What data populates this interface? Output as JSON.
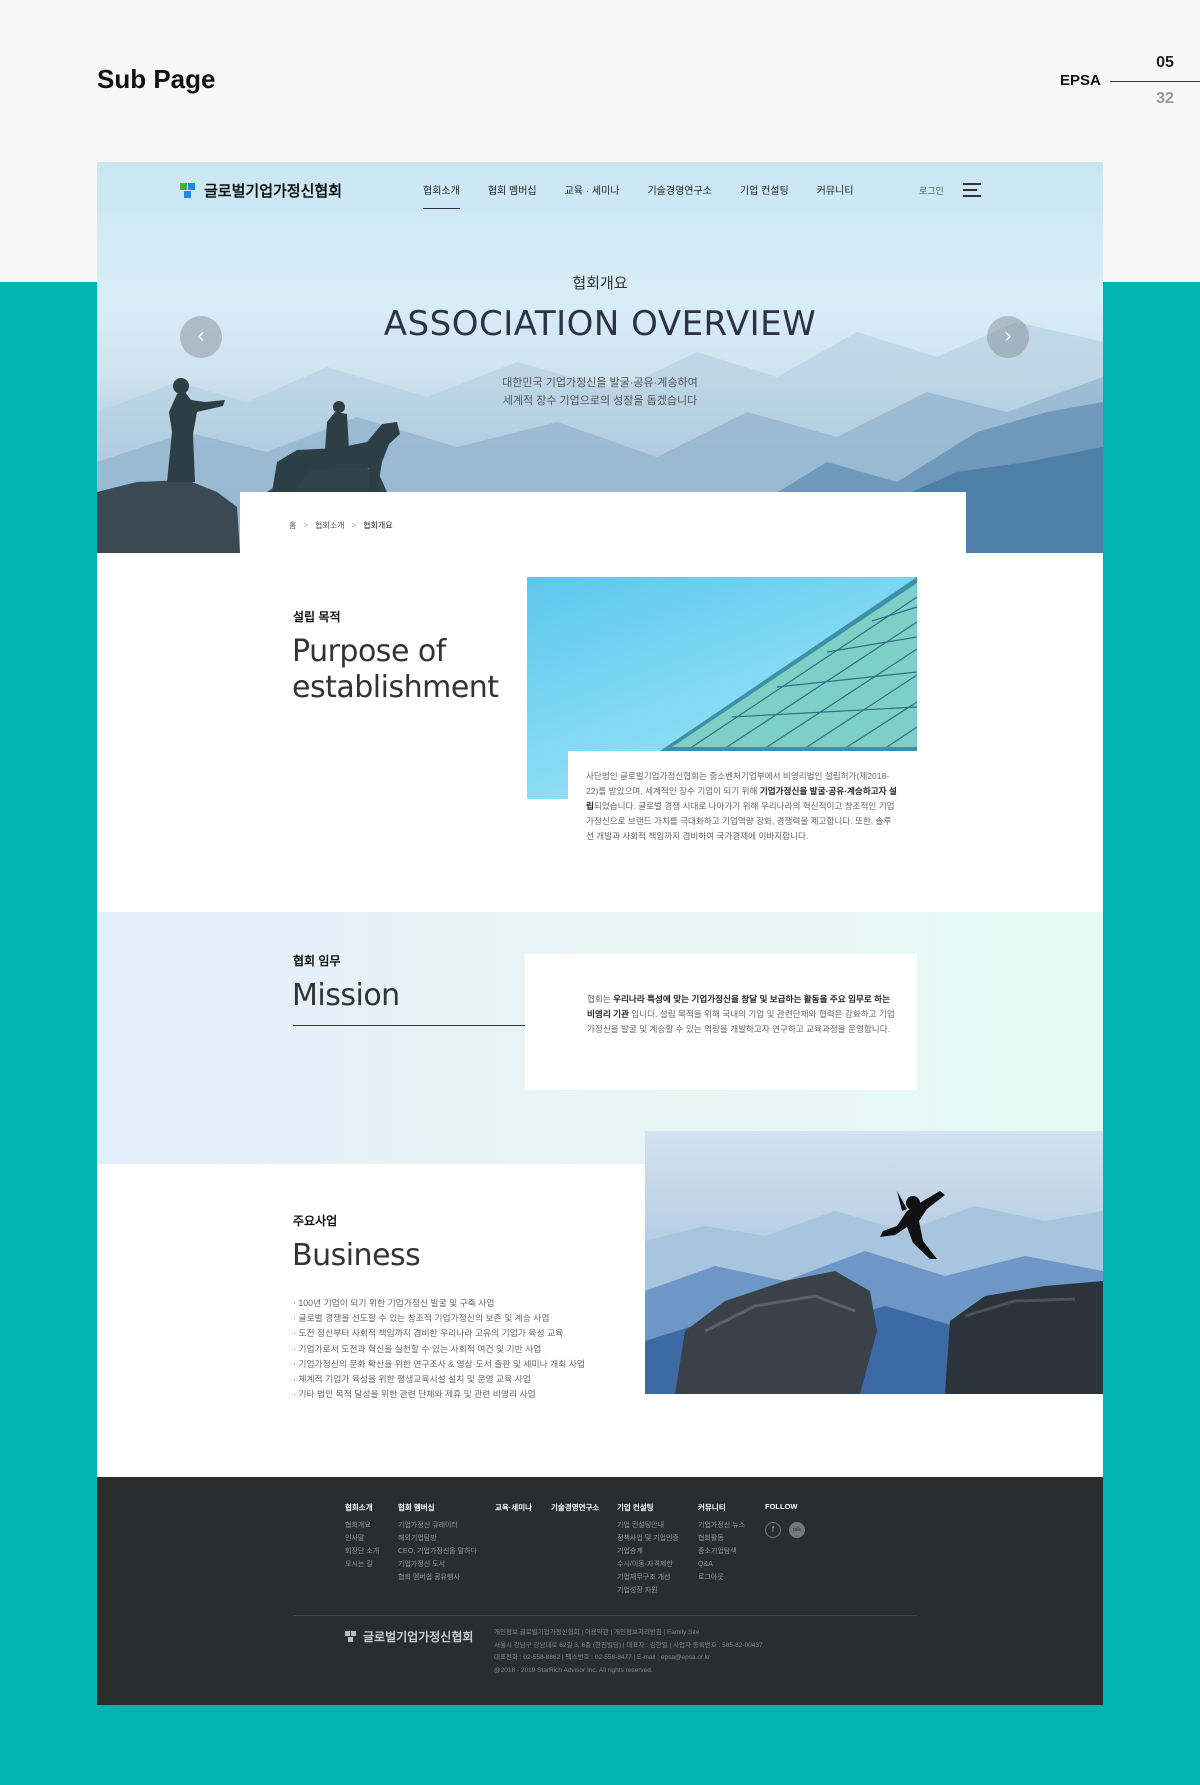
{
  "page": {
    "title": "Sub Page",
    "brand": "EPSA",
    "current_page": "05",
    "total_pages": "32"
  },
  "header": {
    "logo_text": "글로벌기업가정신협회",
    "nav": [
      "협회소개",
      "협회 멤버십",
      "교육 · 세미나",
      "기술경영연구소",
      "기업 컨설팅",
      "커뮤니티"
    ],
    "active_nav": "협회소개",
    "login": "로그인"
  },
  "hero": {
    "title_kr": "협회개요",
    "title_en": "ASSOCIATION OVERVIEW",
    "subtitle_1": "대한민국 기업가정신을 발굴·공유·계승하여",
    "subtitle_2": "세계적 장수 기업으로의 성장을 돕겠습니다",
    "prev": "‹",
    "next": "›"
  },
  "breadcrumb": [
    "홈",
    "협회소개",
    "협회개요"
  ],
  "purpose": {
    "label": "설립 목적",
    "title_1": "Purpose of",
    "title_2": "establishment",
    "body_1": "사단법인 글로벌기업가정신협회는 중소벤처기업부에서 비영리법인 설립허가(제2018-22)를 받았으며, 세계적인 장수 기업이 되기 위해 ",
    "body_bold": "기업가정신을 발굴·공유·계승하고자 설립",
    "body_2": "되었습니다. 글로벌 경쟁 시대로 나아가기 위해 우리나라의 혁신적이고 창조적인 기업가정신으로 브랜드 가치를 극대화하고 기업역량 강화, 경쟁력을 제고합니다. 또한, 솔루션 개발과 사회적 책임까지 겸비하여 국가경제에 이바지합니다."
  },
  "mission": {
    "label": "협회 임무",
    "title": "Mission",
    "body_1": "협회는 ",
    "body_bold": "우리나라 특성에 맞는 기업가정신을 창달 및 보급하는 활동을 주요 임무로 하는 비영리 기관",
    "body_2": " 입니다. 설립 목적을 위해 국내의 기업 및 관련단체와 협력은 강화하고 기업가정신을 발굴 및 계승할 수 있는 역량을 개발하고자 연구하고 교육과정을 운영합니다."
  },
  "business": {
    "label": "주요사업",
    "title": "Business",
    "items": [
      "· 100년 기업이 되기 위한 기업가정신 발굴 및 구축 사업",
      "· 글로벌 경쟁을 선도할 수 있는 창조적 기업가정신의 보존 및 계승 사업",
      "· 도전 정신부터 사회적 책임까지 겸비한 우리나라 고유의 기업가 육성 교육",
      "· 기업가로서 도전과 혁신을 실천할 수 있는 사회적 여건 및 기반 사업",
      "· 기업가정신의 문화 확산을 위한 연구조사 & 영상·도서 출판 및 세미나 개최 사업",
      "· 체계적 기업가 육성을 위한 평생교육시설 설치 및 운영 교육 사업",
      "· 기타 법인 목적 달성을 위한 관련 단체와 제휴 및 관련 비영리 사업"
    ]
  },
  "footer": {
    "columns": [
      {
        "heading": "협회소개",
        "items": [
          "협회개요",
          "인사말",
          "회장단 소개",
          "오시는 길"
        ]
      },
      {
        "heading": "협회 멤버십",
        "items": [
          "기업가정신 큐레이터",
          "해외기업탐방",
          "CEO, 기업가정신을 말하다",
          "기업가정신 도서",
          "협회 멤버쉽 공유행사"
        ]
      },
      {
        "heading": "교육·세미나",
        "items": []
      },
      {
        "heading": "기술경영연구소",
        "items": []
      },
      {
        "heading": "기업 컨설팅",
        "items": [
          "기업 컨설팅안내",
          "정책사업 및 기업인증",
          "기업승계",
          "수시/이동·자격제한",
          "기업재무구조 개선",
          "기업성장 지원"
        ]
      },
      {
        "heading": "커뮤니티",
        "items": [
          "기업가정신 뉴스",
          "협회활동",
          "중소기업탐색",
          "Q&A",
          "로그아웃"
        ]
      },
      {
        "heading": "FOLLOW",
        "items": []
      }
    ],
    "social": [
      "f",
      "talk"
    ],
    "logo_text": "글로벌기업가정신협회",
    "info": [
      "개인정보 글로벌기업가정신협회  |  이용약관  |  개인정보처리방침  |  Family Site",
      "서울시 강남구 강남대로 62길 3, 6층 (한진빌딩)  |  대표자 : 김한얼  |  사업자 등록번호 : 585-82-00437",
      "대표전화 : 02-558-8862  |  팩스번호 : 02-558-8477  |  E-mail : epsa@epsa.or.kr",
      "@2018 - 2019 StarRich Advisor Inc. All rights reserved."
    ]
  },
  "colors": {
    "teal": "#00b4b4",
    "footer": "#2b2c2e",
    "logo_green": "#3cb043",
    "logo_blue": "#1e88e5"
  }
}
